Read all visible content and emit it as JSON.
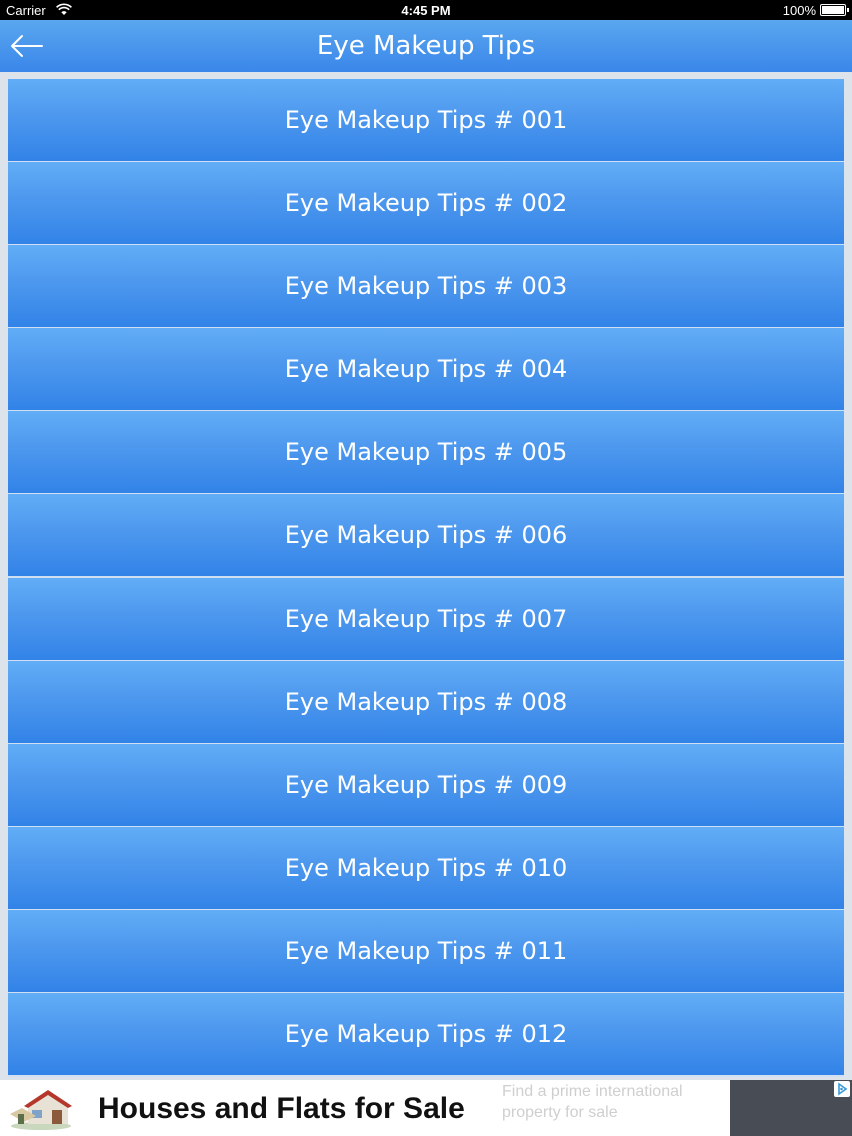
{
  "status_bar": {
    "carrier": "Carrier",
    "time": "4:45 PM",
    "battery": "100%"
  },
  "nav": {
    "title": "Eye Makeup Tips",
    "back_icon": "back-arrow-icon"
  },
  "list": {
    "items": [
      "Eye Makeup Tips # 001",
      "Eye Makeup Tips # 002",
      "Eye Makeup Tips # 003",
      "Eye Makeup Tips # 004",
      "Eye Makeup Tips # 005",
      "Eye Makeup Tips # 006",
      "Eye Makeup Tips # 007",
      "Eye Makeup Tips # 008",
      "Eye Makeup Tips # 009",
      "Eye Makeup Tips # 010",
      "Eye Makeup Tips # 011",
      "Eye Makeup Tips # 012"
    ]
  },
  "ad": {
    "headline": "Houses and Flats for Sale",
    "faded_line1": "Find a prime international",
    "faded_line2": "property for sale"
  },
  "colors": {
    "accent": "#3a86ea",
    "nav_top": "#5aa7ef",
    "item_top": "#62adf6",
    "item_bottom": "#3283e8",
    "ad_panel": "#484d55"
  }
}
